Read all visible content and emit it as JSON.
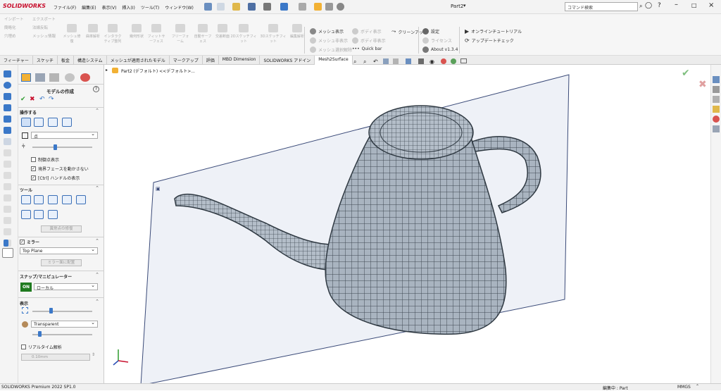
{
  "app": {
    "brand": "SOLIDWORKS",
    "document_title": "Part2",
    "search_placeholder": "コマンド検索"
  },
  "menu": [
    "ファイル(F)",
    "編集(E)",
    "表示(V)",
    "挿入(I)",
    "ツール(T)",
    "ウィンドウ(W)"
  ],
  "ribbon": {
    "group1": [
      "インポート",
      "簡略化",
      "穴埋め",
      "ハイブ処理",
      "エクスポート",
      "法線反転",
      "メッシュ情報",
      "メッシュ修復"
    ],
    "group2": [
      "曲率解析",
      "インタラクティブ整列",
      "幾何形状",
      "フィットサーフェス",
      "フリーフォーム",
      "自動サーフェス",
      "交差断面",
      "2Dスケッチフィット",
      "3Dスケッチフィット",
      "編集解析"
    ],
    "mesh": [
      "メッシュ表示",
      "メッシュ非表示",
      "メッシュ選択解除",
      "ボディ表示",
      "ボディ非表示",
      "Quick bar",
      "クリーンアップ"
    ],
    "settings": [
      "設定",
      "ライセンス",
      "About v1.3.4",
      "オンラインチュートリアル",
      "アップデートチェック"
    ]
  },
  "tabs": [
    "フィーチャー",
    "スケッチ",
    "板金",
    "構造システム",
    "メッシュが適用されたモデル",
    "マークアップ",
    "評価",
    "MBD Dimension",
    "SOLIDWORKS アドイン",
    "Mesh2Surface"
  ],
  "tree": {
    "label": "Part2 (デフォルト) <<デフォルト>..."
  },
  "pm": {
    "title": "モデルの作成",
    "operate": {
      "heading": "操作する",
      "select_value": "点",
      "cb_vertices": "制御点表示",
      "cb_boundary": "境界フェースを動かさない",
      "cb_handle": "[Ctrl] ハンドルの表示"
    },
    "tools": {
      "heading": "ツール",
      "button": "異常点の修復"
    },
    "mirror": {
      "heading": "ミラー",
      "plane": "Top Plane",
      "button": "ミラー面に配置"
    },
    "snap": {
      "heading": "スナップ/マニピュレーター",
      "toggle": "ON",
      "mode": "ローカル"
    },
    "display": {
      "heading": "表示",
      "mode": "Transparent",
      "cb_realtime": "リアルタイム解析",
      "value": "0.10mm"
    }
  },
  "status": {
    "left": "SOLIDWORKS Premium 2022 SP1.0",
    "editing": "編集中 : Part",
    "units": "MMGS"
  },
  "colors": {
    "accent": "#3b78c8",
    "brand": "#c8102e",
    "mesh": "#5f6f7d",
    "plane": "#eef1f7"
  }
}
